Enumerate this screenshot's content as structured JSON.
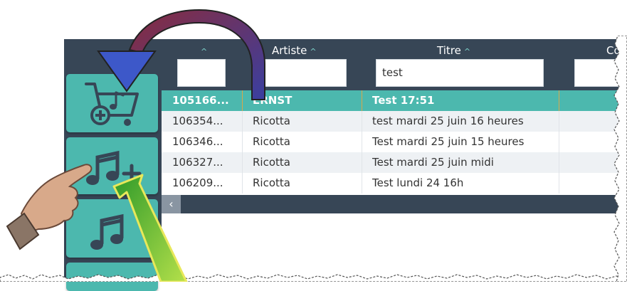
{
  "columns": {
    "col1_caret": "^",
    "artiste": "Artiste",
    "titre": "Titre",
    "co": "Co",
    "sort_caret": "^"
  },
  "filters": {
    "id_value": "",
    "artiste_value": "",
    "titre_value": "test",
    "co_value": ""
  },
  "rows": [
    {
      "id": "105166...",
      "artiste": "ERNST",
      "titre": "Test 17:51",
      "selected": true
    },
    {
      "id": "106354...",
      "artiste": "Ricotta",
      "titre": "test mardi 25 juin 16 heures",
      "selected": false
    },
    {
      "id": "106346...",
      "artiste": "Ricotta",
      "titre": "Test mardi 25 juin 15 heures",
      "selected": false
    },
    {
      "id": "106327...",
      "artiste": "Ricotta",
      "titre": "Test mardi 25 juin midi",
      "selected": false
    },
    {
      "id": "106209...",
      "artiste": "Ricotta",
      "titre": "Test lundi 24 16h",
      "selected": false
    }
  ],
  "scroll_left_glyph": "‹",
  "colors": {
    "dark_band": "#374656",
    "teal": "#4cb8ae",
    "selected_row": "#4cb8ae",
    "alt_row": "#eef1f4",
    "curved_arrow_start": "#8a2b3c",
    "curved_arrow_end": "#3a3fa0",
    "down_arrow": "#3d58c9",
    "green_arrow": "#5cbf3a"
  },
  "icons": [
    "cart-music-icon",
    "music-add-icon",
    "music-notes-icon",
    "hand-pointer-icon",
    "curved-arrow-icon",
    "green-arrow-icon"
  ]
}
